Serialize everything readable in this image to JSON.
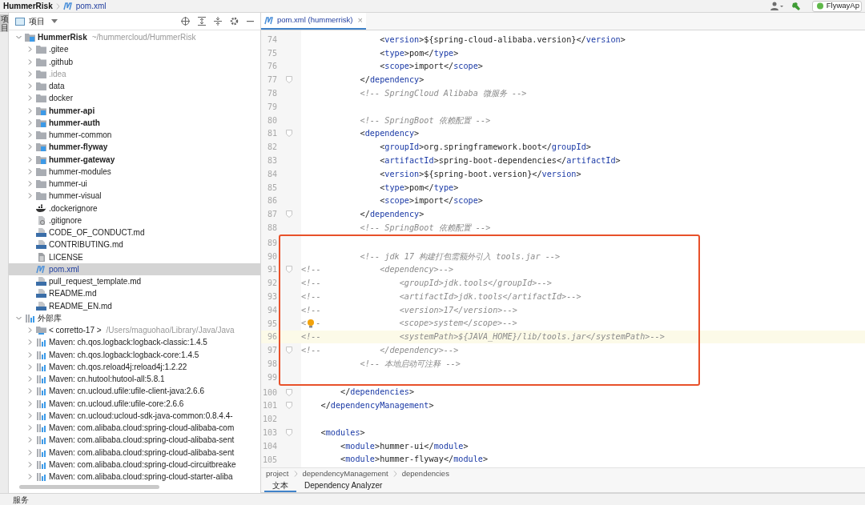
{
  "title_bar": {
    "breadcrumbs": [
      {
        "text": "HummerRisk",
        "kind": "project"
      },
      {
        "text": "pom.xml",
        "kind": "maven"
      }
    ],
    "run_config": "FlywayAp"
  },
  "tool_strip": {
    "label": "项目"
  },
  "project_panel": {
    "title": "项目",
    "tree": [
      {
        "name": "HummerRisk",
        "kind": "module",
        "bold": true,
        "dim": false,
        "selected": false,
        "expanded": true,
        "path": "~/hummercloud/HummerRisk",
        "children": [
          {
            "name": ".gitee",
            "kind": "folder",
            "bold": false,
            "dim": false,
            "selected": false,
            "expanded": false
          },
          {
            "name": ".github",
            "kind": "folder",
            "bold": false,
            "dim": false,
            "selected": false,
            "expanded": false
          },
          {
            "name": ".idea",
            "kind": "folder",
            "bold": false,
            "dim": true,
            "selected": false,
            "expanded": false
          },
          {
            "name": "data",
            "kind": "folder",
            "bold": false,
            "dim": false,
            "selected": false,
            "expanded": false
          },
          {
            "name": "docker",
            "kind": "folder",
            "bold": false,
            "dim": false,
            "selected": false,
            "expanded": false
          },
          {
            "name": "hummer-api",
            "kind": "module",
            "bold": true,
            "dim": false,
            "selected": false,
            "expanded": false
          },
          {
            "name": "hummer-auth",
            "kind": "module",
            "bold": true,
            "dim": false,
            "selected": false,
            "expanded": false
          },
          {
            "name": "hummer-common",
            "kind": "folder",
            "bold": false,
            "dim": false,
            "selected": false,
            "expanded": false
          },
          {
            "name": "hummer-flyway",
            "kind": "module",
            "bold": true,
            "dim": false,
            "selected": false,
            "expanded": false
          },
          {
            "name": "hummer-gateway",
            "kind": "module",
            "bold": true,
            "dim": false,
            "selected": false,
            "expanded": false
          },
          {
            "name": "hummer-modules",
            "kind": "folder",
            "bold": false,
            "dim": false,
            "selected": false,
            "expanded": false
          },
          {
            "name": "hummer-ui",
            "kind": "folder",
            "bold": false,
            "dim": false,
            "selected": false,
            "expanded": false
          },
          {
            "name": "hummer-visual",
            "kind": "folder",
            "bold": false,
            "dim": false,
            "selected": false,
            "expanded": false
          },
          {
            "name": ".dockerignore",
            "kind": "docker",
            "bold": false,
            "dim": false,
            "selected": false
          },
          {
            "name": ".gitignore",
            "kind": "ignore",
            "bold": false,
            "dim": false,
            "selected": false
          },
          {
            "name": "CODE_OF_CONDUCT.md",
            "kind": "markdown",
            "bold": false,
            "dim": false,
            "selected": false
          },
          {
            "name": "CONTRIBUTING.md",
            "kind": "markdown",
            "bold": false,
            "dim": false,
            "selected": false
          },
          {
            "name": "LICENSE",
            "kind": "text",
            "bold": false,
            "dim": false,
            "selected": false
          },
          {
            "name": "pom.xml",
            "kind": "maven",
            "bold": false,
            "dim": false,
            "selected": true
          },
          {
            "name": "pull_request_template.md",
            "kind": "markdown",
            "bold": false,
            "dim": false,
            "selected": false
          },
          {
            "name": "README.md",
            "kind": "markdown",
            "bold": false,
            "dim": false,
            "selected": false
          },
          {
            "name": "README_EN.md",
            "kind": "markdown",
            "bold": false,
            "dim": false,
            "selected": false
          }
        ]
      },
      {
        "name": "外部库",
        "kind": "library",
        "bold": false,
        "dim": false,
        "selected": false,
        "expanded": true,
        "children": [
          {
            "name": "< corretto-17 >",
            "kind": "jdk",
            "bold": false,
            "dim": false,
            "selected": false,
            "expanded": false,
            "path": "/Users/maguohao/Library/Java/Java"
          },
          {
            "name": "Maven: ch.qos.logback:logback-classic:1.4.5",
            "kind": "library",
            "bold": false,
            "dim": false,
            "selected": false,
            "expanded": false
          },
          {
            "name": "Maven: ch.qos.logback:logback-core:1.4.5",
            "kind": "library",
            "bold": false,
            "dim": false,
            "selected": false,
            "expanded": false
          },
          {
            "name": "Maven: ch.qos.reload4j:reload4j:1.2.22",
            "kind": "library",
            "bold": false,
            "dim": false,
            "selected": false,
            "expanded": false
          },
          {
            "name": "Maven: cn.hutool:hutool-all:5.8.1",
            "kind": "library",
            "bold": false,
            "dim": false,
            "selected": false,
            "expanded": false
          },
          {
            "name": "Maven: cn.ucloud.ufile:ufile-client-java:2.6.6",
            "kind": "library",
            "bold": false,
            "dim": false,
            "selected": false,
            "expanded": false
          },
          {
            "name": "Maven: cn.ucloud.ufile:ufile-core:2.6.6",
            "kind": "library",
            "bold": false,
            "dim": false,
            "selected": false,
            "expanded": false
          },
          {
            "name": "Maven: cn.ucloud:ucloud-sdk-java-common:0.8.4.4-",
            "kind": "library",
            "bold": false,
            "dim": false,
            "selected": false,
            "expanded": false
          },
          {
            "name": "Maven: com.alibaba.cloud:spring-cloud-alibaba-com",
            "kind": "library",
            "bold": false,
            "dim": false,
            "selected": false,
            "expanded": false
          },
          {
            "name": "Maven: com.alibaba.cloud:spring-cloud-alibaba-sent",
            "kind": "library",
            "bold": false,
            "dim": false,
            "selected": false,
            "expanded": false
          },
          {
            "name": "Maven: com.alibaba.cloud:spring-cloud-alibaba-sent",
            "kind": "library",
            "bold": false,
            "dim": false,
            "selected": false,
            "expanded": false
          },
          {
            "name": "Maven: com.alibaba.cloud:spring-cloud-circuitbreake",
            "kind": "library",
            "bold": false,
            "dim": false,
            "selected": false,
            "expanded": false
          },
          {
            "name": "Maven: com.alibaba.cloud:spring-cloud-starter-aliba",
            "kind": "library",
            "bold": false,
            "dim": false,
            "selected": false,
            "expanded": false
          }
        ]
      }
    ]
  },
  "editor": {
    "tabs": [
      {
        "label": "pom.xml (hummerrisk)",
        "selected": true,
        "close": "×"
      }
    ],
    "code_before": [
      {
        "num": "74",
        "fold": false,
        "current": false,
        "code": [
          {
            "kind": "text",
            "text": "                <"
          },
          {
            "kind": "tag",
            "text": "version"
          },
          {
            "kind": "text",
            "text": ">${spring-cloud-alibaba.version}</"
          },
          {
            "kind": "tag",
            "text": "version"
          },
          {
            "kind": "text",
            "text": ">"
          }
        ]
      },
      {
        "num": "75",
        "fold": false,
        "current": false,
        "code": [
          {
            "kind": "text",
            "text": "                <"
          },
          {
            "kind": "tag",
            "text": "type"
          },
          {
            "kind": "text",
            "text": ">pom</"
          },
          {
            "kind": "tag",
            "text": "type"
          },
          {
            "kind": "text",
            "text": ">"
          }
        ]
      },
      {
        "num": "76",
        "fold": false,
        "current": false,
        "code": [
          {
            "kind": "text",
            "text": "                <"
          },
          {
            "kind": "tag",
            "text": "scope"
          },
          {
            "kind": "text",
            "text": ">import</"
          },
          {
            "kind": "tag",
            "text": "scope"
          },
          {
            "kind": "text",
            "text": ">"
          }
        ]
      },
      {
        "num": "77",
        "fold": true,
        "current": false,
        "code": [
          {
            "kind": "text",
            "text": "            </"
          },
          {
            "kind": "tag",
            "text": "dependency"
          },
          {
            "kind": "text",
            "text": ">"
          }
        ]
      },
      {
        "num": "78",
        "fold": false,
        "current": false,
        "code": [
          {
            "kind": "comment",
            "text": "            <!-- SpringCloud Alibaba 微服务 -->"
          }
        ]
      },
      {
        "num": "79",
        "fold": false,
        "current": false
      },
      {
        "num": "80",
        "fold": false,
        "current": false,
        "code": [
          {
            "kind": "comment",
            "text": "            <!-- SpringBoot 依赖配置 -->"
          }
        ]
      },
      {
        "num": "81",
        "fold": true,
        "current": false,
        "code": [
          {
            "kind": "text",
            "text": "            <"
          },
          {
            "kind": "tag",
            "text": "dependency"
          },
          {
            "kind": "text",
            "text": ">"
          }
        ]
      },
      {
        "num": "82",
        "fold": false,
        "current": false,
        "code": [
          {
            "kind": "text",
            "text": "                <"
          },
          {
            "kind": "tag",
            "text": "groupId"
          },
          {
            "kind": "text",
            "text": ">org.springframework.boot</"
          },
          {
            "kind": "tag",
            "text": "groupId"
          },
          {
            "kind": "text",
            "text": ">"
          }
        ]
      },
      {
        "num": "83",
        "fold": false,
        "current": false,
        "code": [
          {
            "kind": "text",
            "text": "                <"
          },
          {
            "kind": "tag",
            "text": "artifactId"
          },
          {
            "kind": "text",
            "text": ">spring-boot-dependencies</"
          },
          {
            "kind": "tag",
            "text": "artifactId"
          },
          {
            "kind": "text",
            "text": ">"
          }
        ]
      },
      {
        "num": "84",
        "fold": false,
        "current": false,
        "code": [
          {
            "kind": "text",
            "text": "                <"
          },
          {
            "kind": "tag",
            "text": "version"
          },
          {
            "kind": "text",
            "text": ">${spring-boot.version}</"
          },
          {
            "kind": "tag",
            "text": "version"
          },
          {
            "kind": "text",
            "text": ">"
          }
        ]
      },
      {
        "num": "85",
        "fold": false,
        "current": false,
        "code": [
          {
            "kind": "text",
            "text": "                <"
          },
          {
            "kind": "tag",
            "text": "type"
          },
          {
            "kind": "text",
            "text": ">pom</"
          },
          {
            "kind": "tag",
            "text": "type"
          },
          {
            "kind": "text",
            "text": ">"
          }
        ]
      },
      {
        "num": "86",
        "fold": false,
        "current": false,
        "code": [
          {
            "kind": "text",
            "text": "                <"
          },
          {
            "kind": "tag",
            "text": "scope"
          },
          {
            "kind": "text",
            "text": ">import</"
          },
          {
            "kind": "tag",
            "text": "scope"
          },
          {
            "kind": "text",
            "text": ">"
          }
        ]
      },
      {
        "num": "87",
        "fold": true,
        "current": false,
        "code": [
          {
            "kind": "text",
            "text": "            </"
          },
          {
            "kind": "tag",
            "text": "dependency"
          },
          {
            "kind": "text",
            "text": ">"
          }
        ]
      },
      {
        "num": "88",
        "fold": false,
        "current": false,
        "code": [
          {
            "kind": "comment",
            "text": "            <!-- SpringBoot 依赖配置 -->"
          }
        ]
      }
    ],
    "code_boxed": [
      {
        "num": "89",
        "fold": false,
        "current": false
      },
      {
        "num": "90",
        "fold": false,
        "current": false,
        "code": [
          {
            "kind": "comment",
            "text": "            <!-- jdk 17 构建打包需额外引入 tools.jar -->"
          }
        ]
      },
      {
        "num": "91",
        "fold": true,
        "current": false,
        "code": [
          {
            "kind": "comment",
            "text": "<!--            <dependency>-->"
          }
        ]
      },
      {
        "num": "92",
        "fold": false,
        "current": false,
        "code": [
          {
            "kind": "comment",
            "text": "<!--                <groupId>jdk.tools</groupId>-->"
          }
        ]
      },
      {
        "num": "93",
        "fold": false,
        "current": false,
        "code": [
          {
            "kind": "comment",
            "text": "<!--                <artifactId>jdk.tools</artifactId>-->"
          }
        ]
      },
      {
        "num": "94",
        "fold": false,
        "current": false,
        "code": [
          {
            "kind": "comment",
            "text": "<!--                <version>17</version>-->"
          }
        ]
      },
      {
        "num": "95",
        "fold": false,
        "current": false,
        "code": [
          {
            "kind": "comment",
            "text": "<"
          },
          {
            "kind": "bulb"
          },
          {
            "kind": "comment",
            "text": "-                <scope>system</scope>-->"
          }
        ]
      },
      {
        "num": "96",
        "fold": false,
        "current": true,
        "code": [
          {
            "kind": "comment",
            "text": "<!--                <systemPath>${JAVA_HOME}/lib/tools.jar</systemPath>-->"
          }
        ]
      },
      {
        "num": "97",
        "fold": true,
        "current": false,
        "code": [
          {
            "kind": "comment",
            "text": "<!--            </dependency>-->"
          }
        ]
      },
      {
        "num": "98",
        "fold": false,
        "current": false,
        "code": [
          {
            "kind": "comment",
            "text": "            <!-- 本地启动可注释 -->"
          }
        ]
      },
      {
        "num": "99",
        "fold": false,
        "current": false
      }
    ],
    "code_after": [
      {
        "num": "100",
        "fold": true,
        "current": false,
        "code": [
          {
            "kind": "text",
            "text": "        </"
          },
          {
            "kind": "tag",
            "text": "dependencies"
          },
          {
            "kind": "text",
            "text": ">"
          }
        ]
      },
      {
        "num": "101",
        "fold": true,
        "current": false,
        "code": [
          {
            "kind": "text",
            "text": "    </"
          },
          {
            "kind": "tag",
            "text": "dependencyManagement"
          },
          {
            "kind": "text",
            "text": ">"
          }
        ]
      },
      {
        "num": "102",
        "fold": false,
        "current": false
      },
      {
        "num": "103",
        "fold": true,
        "current": false,
        "code": [
          {
            "kind": "text",
            "text": "    <"
          },
          {
            "kind": "tag",
            "text": "modules"
          },
          {
            "kind": "text",
            "text": ">"
          }
        ]
      },
      {
        "num": "104",
        "fold": false,
        "current": false,
        "code": [
          {
            "kind": "text",
            "text": "        <"
          },
          {
            "kind": "tag",
            "text": "module"
          },
          {
            "kind": "text",
            "text": ">hummer-ui</"
          },
          {
            "kind": "tag",
            "text": "module"
          },
          {
            "kind": "text",
            "text": ">"
          }
        ]
      },
      {
        "num": "105",
        "fold": false,
        "current": false,
        "code": [
          {
            "kind": "text",
            "text": "        <"
          },
          {
            "kind": "tag",
            "text": "module"
          },
          {
            "kind": "text",
            "text": ">hummer-flyway</"
          },
          {
            "kind": "tag",
            "text": "module"
          },
          {
            "kind": "text",
            "text": ">"
          }
        ]
      }
    ],
    "breadcrumbs": [
      "project",
      "dependencyManagement",
      "dependencies"
    ],
    "bottom_tabs": [
      {
        "label": "文本",
        "selected": true
      },
      {
        "label": "Dependency Analyzer",
        "selected": false
      }
    ]
  },
  "status_bar": {
    "label": "服务"
  }
}
